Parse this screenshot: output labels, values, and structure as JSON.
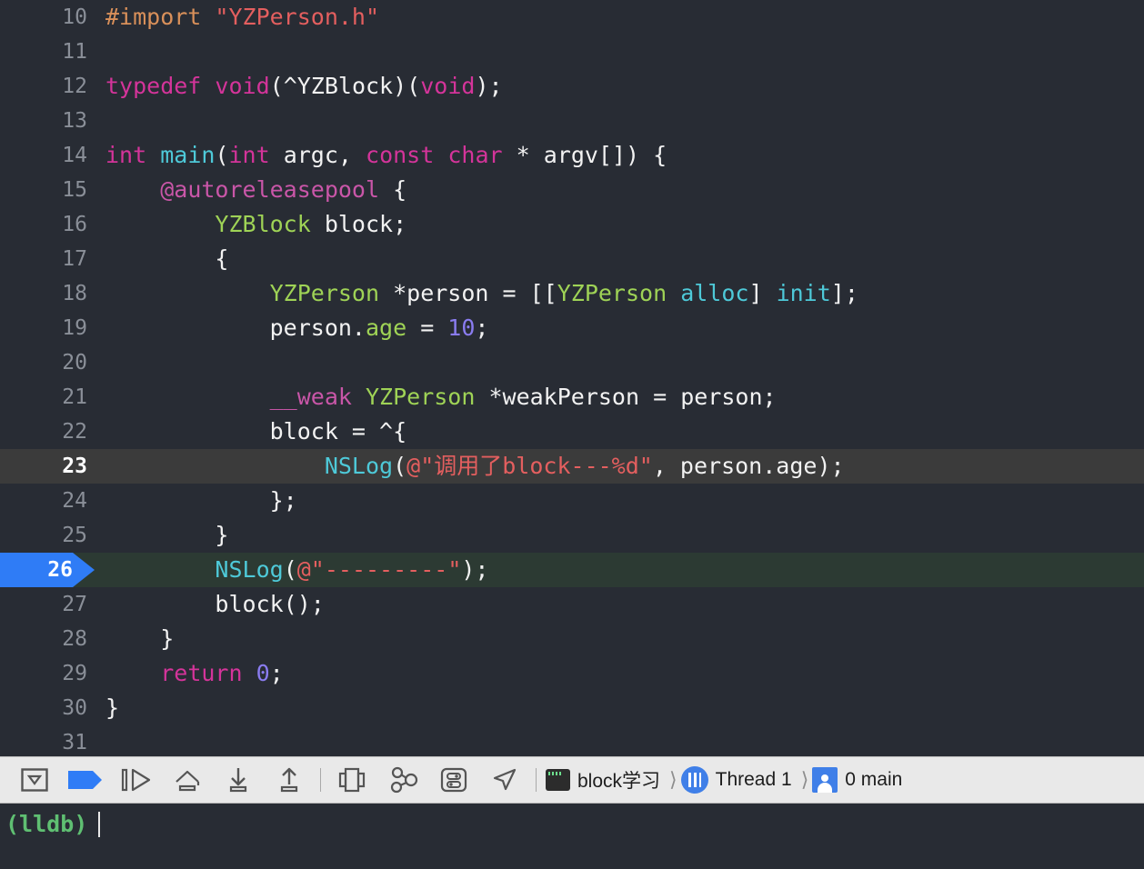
{
  "editor": {
    "first_line_number": 10,
    "cursor_line": 23,
    "execution_line": 26,
    "lines": [
      {
        "n": "10",
        "tokens": [
          {
            "t": "#import ",
            "c": "t-pre"
          },
          {
            "t": "\"YZPerson.h\"",
            "c": "t-str"
          }
        ]
      },
      {
        "n": "11",
        "tokens": []
      },
      {
        "n": "12",
        "tokens": [
          {
            "t": "typedef ",
            "c": "t-kw"
          },
          {
            "t": "void",
            "c": "t-kw"
          },
          {
            "t": "(^",
            "c": "t-plain"
          },
          {
            "t": "YZBlock",
            "c": "t-plain"
          },
          {
            "t": ")(",
            "c": "t-plain"
          },
          {
            "t": "void",
            "c": "t-kw"
          },
          {
            "t": ");",
            "c": "t-plain"
          }
        ]
      },
      {
        "n": "13",
        "tokens": []
      },
      {
        "n": "14",
        "tokens": [
          {
            "t": "int ",
            "c": "t-kw"
          },
          {
            "t": "main",
            "c": "t-fn"
          },
          {
            "t": "(",
            "c": "t-plain"
          },
          {
            "t": "int",
            "c": "t-kw"
          },
          {
            "t": " argc, ",
            "c": "t-plain"
          },
          {
            "t": "const",
            "c": "t-kw"
          },
          {
            "t": " ",
            "c": "t-plain"
          },
          {
            "t": "char",
            "c": "t-kw"
          },
          {
            "t": " * argv[]) {",
            "c": "t-plain"
          }
        ]
      },
      {
        "n": "15",
        "tokens": [
          {
            "t": "    ",
            "c": "t-plain"
          },
          {
            "t": "@autoreleasepool",
            "c": "t-kw2"
          },
          {
            "t": " {",
            "c": "t-plain"
          }
        ]
      },
      {
        "n": "16",
        "tokens": [
          {
            "t": "        ",
            "c": "t-plain"
          },
          {
            "t": "YZBlock",
            "c": "t-type"
          },
          {
            "t": " block;",
            "c": "t-plain"
          }
        ]
      },
      {
        "n": "17",
        "tokens": [
          {
            "t": "        {",
            "c": "t-plain"
          }
        ]
      },
      {
        "n": "18",
        "tokens": [
          {
            "t": "            ",
            "c": "t-plain"
          },
          {
            "t": "YZPerson",
            "c": "t-type"
          },
          {
            "t": " *person = [[",
            "c": "t-plain"
          },
          {
            "t": "YZPerson",
            "c": "t-type"
          },
          {
            "t": " ",
            "c": "t-plain"
          },
          {
            "t": "alloc",
            "c": "t-fn"
          },
          {
            "t": "] ",
            "c": "t-plain"
          },
          {
            "t": "init",
            "c": "t-fn"
          },
          {
            "t": "];",
            "c": "t-plain"
          }
        ]
      },
      {
        "n": "19",
        "tokens": [
          {
            "t": "            person.",
            "c": "t-plain"
          },
          {
            "t": "age",
            "c": "t-type"
          },
          {
            "t": " = ",
            "c": "t-plain"
          },
          {
            "t": "10",
            "c": "t-num"
          },
          {
            "t": ";",
            "c": "t-plain"
          }
        ]
      },
      {
        "n": "20",
        "tokens": []
      },
      {
        "n": "21",
        "tokens": [
          {
            "t": "            ",
            "c": "t-plain"
          },
          {
            "t": "__weak",
            "c": "t-kw2"
          },
          {
            "t": " ",
            "c": "t-plain"
          },
          {
            "t": "YZPerson",
            "c": "t-type"
          },
          {
            "t": " *weakPerson = person;",
            "c": "t-plain"
          }
        ]
      },
      {
        "n": "22",
        "tokens": [
          {
            "t": "            block = ^{",
            "c": "t-plain"
          }
        ]
      },
      {
        "n": "23",
        "tokens": [
          {
            "t": "                ",
            "c": "t-plain"
          },
          {
            "t": "NSLog",
            "c": "t-fn"
          },
          {
            "t": "(",
            "c": "t-plain"
          },
          {
            "t": "@\"调用了block---%d\"",
            "c": "t-str"
          },
          {
            "t": ", person.age);",
            "c": "t-plain"
          }
        ]
      },
      {
        "n": "24",
        "tokens": [
          {
            "t": "            };",
            "c": "t-plain"
          }
        ]
      },
      {
        "n": "25",
        "tokens": [
          {
            "t": "        }",
            "c": "t-plain"
          }
        ]
      },
      {
        "n": "26",
        "tokens": [
          {
            "t": "        ",
            "c": "t-plain"
          },
          {
            "t": "NSLog",
            "c": "t-fn"
          },
          {
            "t": "(",
            "c": "t-plain"
          },
          {
            "t": "@\"---------\"",
            "c": "t-str"
          },
          {
            "t": ");",
            "c": "t-plain"
          }
        ]
      },
      {
        "n": "27",
        "tokens": [
          {
            "t": "        block();",
            "c": "t-plain"
          }
        ]
      },
      {
        "n": "28",
        "tokens": [
          {
            "t": "    }",
            "c": "t-plain"
          }
        ]
      },
      {
        "n": "29",
        "tokens": [
          {
            "t": "    ",
            "c": "t-plain"
          },
          {
            "t": "return",
            "c": "t-kw"
          },
          {
            "t": " ",
            "c": "t-plain"
          },
          {
            "t": "0",
            "c": "t-num"
          },
          {
            "t": ";",
            "c": "t-plain"
          }
        ]
      },
      {
        "n": "30",
        "tokens": [
          {
            "t": "}",
            "c": "t-plain"
          }
        ]
      },
      {
        "n": "31",
        "tokens": []
      }
    ]
  },
  "debug_bar": {
    "buttons": [
      {
        "name": "hide-debug-area-button",
        "icon": "panel-toggle-icon",
        "label": "Hide Debug Area"
      },
      {
        "name": "breakpoints-toggle-button",
        "icon": "breakpoint-flag-icon",
        "label": "Deactivate Breakpoints"
      },
      {
        "name": "continue-button",
        "icon": "continue-icon",
        "label": "Continue program execution"
      },
      {
        "name": "step-over-button",
        "icon": "step-over-icon",
        "label": "Step over"
      },
      {
        "name": "step-into-button",
        "icon": "step-into-icon",
        "label": "Step into"
      },
      {
        "name": "step-out-button",
        "icon": "step-out-icon",
        "label": "Step out"
      },
      {
        "name": "debug-view-hierarchy-button",
        "icon": "view-hierarchy-icon",
        "label": "Debug View Hierarchy"
      },
      {
        "name": "debug-memory-graph-button",
        "icon": "memory-graph-icon",
        "label": "Debug Memory Graph"
      },
      {
        "name": "environment-overrides-button",
        "icon": "environment-overrides-icon",
        "label": "Environment Overrides"
      },
      {
        "name": "simulate-location-button",
        "icon": "location-arrow-icon",
        "label": "Simulate Location"
      }
    ],
    "breadcrumb": {
      "process": "block学习",
      "thread": "Thread 1",
      "frame": "0 main"
    }
  },
  "console": {
    "prompt": "(lldb)",
    "input_value": ""
  },
  "colors": {
    "editor_background": "#282c34",
    "cursor_line_background": "#3b3b3b",
    "execution_line_background": "#2c3a33",
    "breakpoint_marker": "#2f7cf6",
    "toolbar_background": "#e9e9e9",
    "prompt_green": "#5fbf72",
    "string_red": "#e45f5f",
    "keyword_pink": "#d4349a",
    "type_green": "#9fd356",
    "function_cyan": "#4ec9d8",
    "number_purple": "#8a7cf0"
  }
}
